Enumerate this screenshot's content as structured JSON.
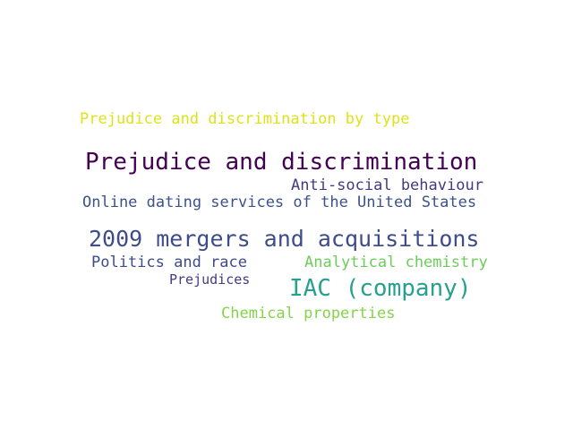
{
  "words": [
    {
      "text": "Prejudice and discrimination by type",
      "color": "#dde318"
    },
    {
      "text": "Prejudice and discrimination",
      "color": "#440154"
    },
    {
      "text": "Anti-social behaviour",
      "color": "#443a83"
    },
    {
      "text": "Online dating services of the United States",
      "color": "#3b528b"
    },
    {
      "text": "2009 mergers and acquisitions",
      "color": "#3e4c8a"
    },
    {
      "text": "Politics and race",
      "color": "#3e4c8a"
    },
    {
      "text": "Analytical chemistry",
      "color": "#6ccd5a"
    },
    {
      "text": "Prejudices",
      "color": "#443a83"
    },
    {
      "text": "IAC (company)",
      "color": "#25a18e"
    },
    {
      "text": "Chemical properties",
      "color": "#84d44b"
    }
  ]
}
